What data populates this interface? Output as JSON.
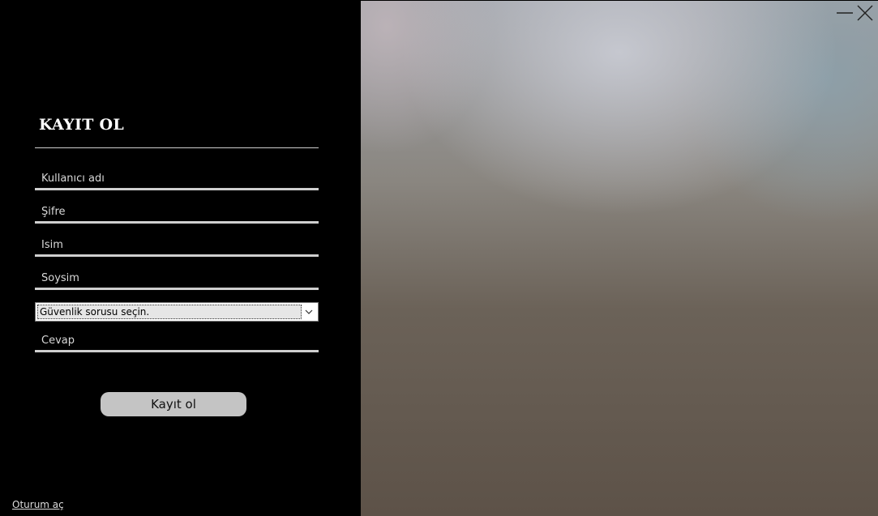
{
  "form": {
    "title": "KAYIT OL",
    "fields": [
      {
        "placeholder": "Kullanıcı adı",
        "value": ""
      },
      {
        "placeholder": "Şifre",
        "value": ""
      },
      {
        "placeholder": "İsim",
        "value": ""
      },
      {
        "placeholder": "Soysim",
        "value": ""
      }
    ],
    "security_question": {
      "selected": "Güvenlik sorusu seçin.",
      "icon": "chevron-down-icon"
    },
    "answer": {
      "placeholder": "Cevap",
      "value": ""
    },
    "submit_label": "Kayıt ol",
    "login_link": "Oturum aç"
  },
  "window_controls": {
    "minimize_icon": "minimize-icon",
    "close_icon": "close-icon"
  },
  "colors": {
    "panel_background": "#000000",
    "text": "#ffffff",
    "underline": "#cfcfcf",
    "button": "#c4c4c4"
  }
}
